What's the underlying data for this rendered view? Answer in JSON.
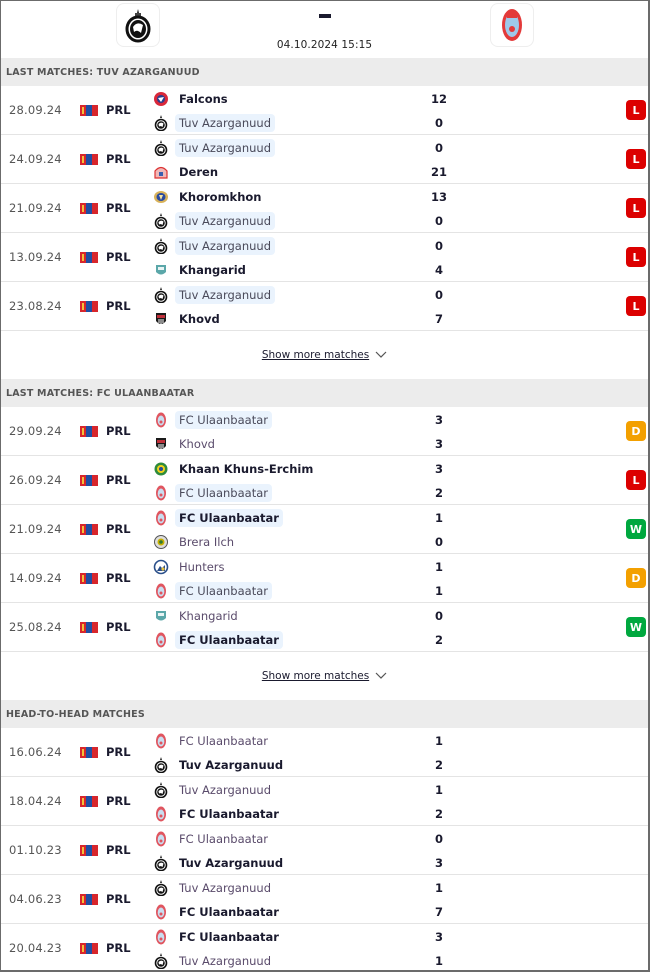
{
  "header": {
    "home_team_logo": "tuv-azarganuud-crest",
    "away_team_logo": "fc-ulaanbaatar-crest",
    "score": "-",
    "datetime": "04.10.2024 15:15"
  },
  "colors": {
    "loss": "#dc0000",
    "draw": "#f3a000",
    "win": "#00a83f",
    "section_bg": "#ececec",
    "highlight_bg": "#eaf3fd"
  },
  "sections": [
    {
      "title": "LAST MATCHES: TUV AZARGANUUD",
      "show_more_label": "Show more matches",
      "matches": [
        {
          "date": "28.09.24",
          "league": "PRL",
          "home": {
            "name": "Falcons",
            "crest": "falcons-crest",
            "bold": true,
            "focus": false
          },
          "away": {
            "name": "Tuv Azarganuud",
            "crest": "tuv-azarganuud-crest",
            "bold": false,
            "focus": true
          },
          "home_score": "12",
          "away_score": "0",
          "result": "L"
        },
        {
          "date": "24.09.24",
          "league": "PRL",
          "home": {
            "name": "Tuv Azarganuud",
            "crest": "tuv-azarganuud-crest",
            "bold": false,
            "focus": true
          },
          "away": {
            "name": "Deren",
            "crest": "deren-crest",
            "bold": true,
            "focus": false
          },
          "home_score": "0",
          "away_score": "21",
          "result": "L"
        },
        {
          "date": "21.09.24",
          "league": "PRL",
          "home": {
            "name": "Khoromkhon",
            "crest": "khoromkhon-crest",
            "bold": true,
            "focus": false
          },
          "away": {
            "name": "Tuv Azarganuud",
            "crest": "tuv-azarganuud-crest",
            "bold": false,
            "focus": true
          },
          "home_score": "13",
          "away_score": "0",
          "result": "L"
        },
        {
          "date": "13.09.24",
          "league": "PRL",
          "home": {
            "name": "Tuv Azarganuud",
            "crest": "tuv-azarganuud-crest",
            "bold": false,
            "focus": true
          },
          "away": {
            "name": "Khangarid",
            "crest": "khangarid-crest",
            "bold": true,
            "focus": false
          },
          "home_score": "0",
          "away_score": "4",
          "result": "L"
        },
        {
          "date": "23.08.24",
          "league": "PRL",
          "home": {
            "name": "Tuv Azarganuud",
            "crest": "tuv-azarganuud-crest",
            "bold": false,
            "focus": true
          },
          "away": {
            "name": "Khovd",
            "crest": "khovd-crest",
            "bold": true,
            "focus": false
          },
          "home_score": "0",
          "away_score": "7",
          "result": "L"
        }
      ]
    },
    {
      "title": "LAST MATCHES: FC ULAANBAATAR",
      "show_more_label": "Show more matches",
      "matches": [
        {
          "date": "29.09.24",
          "league": "PRL",
          "home": {
            "name": "FC Ulaanbaatar",
            "crest": "fc-ulaanbaatar-crest",
            "bold": false,
            "focus": true
          },
          "away": {
            "name": "Khovd",
            "crest": "khovd-crest",
            "bold": false,
            "focus": false
          },
          "home_score": "3",
          "away_score": "3",
          "result": "D"
        },
        {
          "date": "26.09.24",
          "league": "PRL",
          "home": {
            "name": "Khaan Khuns-Erchim",
            "crest": "khaan-khuns-erchim-crest",
            "bold": true,
            "focus": false
          },
          "away": {
            "name": "FC Ulaanbaatar",
            "crest": "fc-ulaanbaatar-crest",
            "bold": false,
            "focus": true
          },
          "home_score": "3",
          "away_score": "2",
          "result": "L"
        },
        {
          "date": "21.09.24",
          "league": "PRL",
          "home": {
            "name": "FC Ulaanbaatar",
            "crest": "fc-ulaanbaatar-crest",
            "bold": true,
            "focus": true
          },
          "away": {
            "name": "Brera Ilch",
            "crest": "brera-ilch-crest",
            "bold": false,
            "focus": false
          },
          "home_score": "1",
          "away_score": "0",
          "result": "W"
        },
        {
          "date": "14.09.24",
          "league": "PRL",
          "home": {
            "name": "Hunters",
            "crest": "hunters-crest",
            "bold": false,
            "focus": false
          },
          "away": {
            "name": "FC Ulaanbaatar",
            "crest": "fc-ulaanbaatar-crest",
            "bold": false,
            "focus": true
          },
          "home_score": "1",
          "away_score": "1",
          "result": "D"
        },
        {
          "date": "25.08.24",
          "league": "PRL",
          "home": {
            "name": "Khangarid",
            "crest": "khangarid-crest",
            "bold": false,
            "focus": false
          },
          "away": {
            "name": "FC Ulaanbaatar",
            "crest": "fc-ulaanbaatar-crest",
            "bold": true,
            "focus": true
          },
          "home_score": "0",
          "away_score": "2",
          "result": "W"
        }
      ]
    },
    {
      "title": "HEAD-TO-HEAD MATCHES",
      "matches": [
        {
          "date": "16.06.24",
          "league": "PRL",
          "home": {
            "name": "FC Ulaanbaatar",
            "crest": "fc-ulaanbaatar-crest",
            "bold": false,
            "focus": false
          },
          "away": {
            "name": "Tuv Azarganuud",
            "crest": "tuv-azarganuud-crest",
            "bold": true,
            "focus": false
          },
          "home_score": "1",
          "away_score": "2",
          "result": ""
        },
        {
          "date": "18.04.24",
          "league": "PRL",
          "home": {
            "name": "Tuv Azarganuud",
            "crest": "tuv-azarganuud-crest",
            "bold": false,
            "focus": false
          },
          "away": {
            "name": "FC Ulaanbaatar",
            "crest": "fc-ulaanbaatar-crest",
            "bold": true,
            "focus": false
          },
          "home_score": "1",
          "away_score": "2",
          "result": ""
        },
        {
          "date": "01.10.23",
          "league": "PRL",
          "home": {
            "name": "FC Ulaanbaatar",
            "crest": "fc-ulaanbaatar-crest",
            "bold": false,
            "focus": false
          },
          "away": {
            "name": "Tuv Azarganuud",
            "crest": "tuv-azarganuud-crest",
            "bold": true,
            "focus": false
          },
          "home_score": "0",
          "away_score": "3",
          "result": ""
        },
        {
          "date": "04.06.23",
          "league": "PRL",
          "home": {
            "name": "Tuv Azarganuud",
            "crest": "tuv-azarganuud-crest",
            "bold": false,
            "focus": false
          },
          "away": {
            "name": "FC Ulaanbaatar",
            "crest": "fc-ulaanbaatar-crest",
            "bold": true,
            "focus": false
          },
          "home_score": "1",
          "away_score": "7",
          "result": ""
        },
        {
          "date": "20.04.23",
          "league": "PRL",
          "home": {
            "name": "FC Ulaanbaatar",
            "crest": "fc-ulaanbaatar-crest",
            "bold": true,
            "focus": false
          },
          "away": {
            "name": "Tuv Azarganuud",
            "crest": "tuv-azarganuud-crest",
            "bold": false,
            "focus": false
          },
          "home_score": "3",
          "away_score": "1",
          "result": ""
        }
      ]
    }
  ]
}
